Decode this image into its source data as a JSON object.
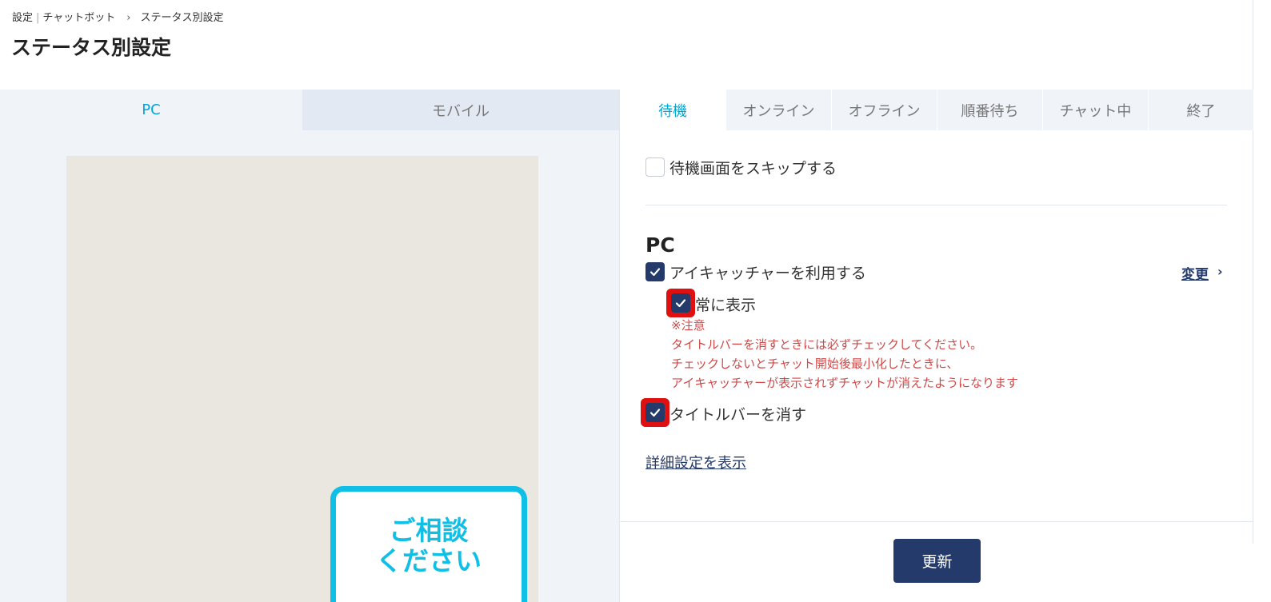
{
  "breadcrumb": {
    "root": "設定",
    "separator": "|",
    "parent": "チャットボット",
    "arrow": "›",
    "current": "ステータス別設定"
  },
  "page_title": "ステータス別設定",
  "device_tabs": [
    {
      "label": "PC",
      "active": true
    },
    {
      "label": "モバイル",
      "active": false
    }
  ],
  "preview": {
    "eyecatcher_text": "ご相談\nください"
  },
  "status_tabs": [
    {
      "label": "待機",
      "active": true
    },
    {
      "label": "オンライン",
      "active": false
    },
    {
      "label": "オフライン",
      "active": false
    },
    {
      "label": "順番待ち",
      "active": false
    },
    {
      "label": "チャット中",
      "active": false
    },
    {
      "label": "終了",
      "active": false
    }
  ],
  "settings": {
    "skip_waiting_label": "待機画面をスキップする",
    "skip_waiting_checked": false,
    "section_title": "PC",
    "use_eyecatcher_label": "アイキャッチャーを利用する",
    "use_eyecatcher_checked": true,
    "change_label": "変更",
    "change_chevron": "›",
    "always_show_label": "常に表示",
    "always_show_checked": true,
    "note_lines": [
      "※注意",
      "タイトルバーを消すときには必ずチェックしてください。",
      "チェックしないとチャット開始後最小化したときに、",
      "アイキャッチャーが表示されずチャットが消えたようになります"
    ],
    "hide_titlebar_label": "タイトルバーを消す",
    "hide_titlebar_checked": true,
    "show_details_label": "詳細設定を表示"
  },
  "update_button_label": "更新",
  "colors": {
    "accent": "#00a6d6",
    "navy": "#243a6b",
    "warning": "#d04848",
    "highlight": "#e01010",
    "eyecatcher": "#10bfe6"
  }
}
